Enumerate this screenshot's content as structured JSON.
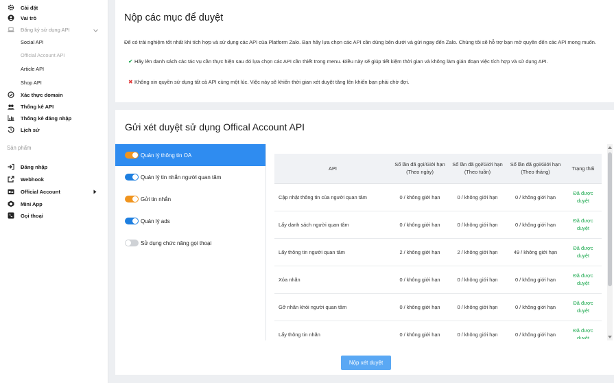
{
  "sidebar": {
    "items": [
      {
        "label": "Cài đặt",
        "icon": "gear-icon"
      },
      {
        "label": "Vai trò",
        "icon": "user-circle-icon"
      },
      {
        "label": "Đăng ký sử dụng API",
        "icon": "laptop-icon"
      },
      {
        "label": "Social API"
      },
      {
        "label": "Official Account API"
      },
      {
        "label": "Article API"
      },
      {
        "label": "Shop API"
      },
      {
        "label": "Xác thực domain",
        "icon": "check-circle-icon"
      },
      {
        "label": "Thống kê API",
        "icon": "users-icon"
      },
      {
        "label": "Thống kê đăng nhập",
        "icon": "bar-chart-icon"
      },
      {
        "label": "Lịch sử",
        "icon": "history-icon"
      }
    ],
    "products_title": "Sản phẩm",
    "products": [
      {
        "label": "Đăng nhập",
        "icon": "sign-in-icon"
      },
      {
        "label": "Webhook",
        "icon": "external-link-icon"
      },
      {
        "label": "Official Account",
        "icon": "oa-icon"
      },
      {
        "label": "Mini App",
        "icon": "mini-app-icon"
      },
      {
        "label": "Gọi thoại",
        "icon": "phone-icon"
      }
    ]
  },
  "intro": {
    "title": "Nộp các mục để duyệt",
    "description": "Để có trải nghiệm tốt nhất khi tích hợp và sử dụng các API của Platform Zalo. Bạn hãy lựa chọn các API cần dùng bên dưới và gửi ngay đến Zalo. Chúng tôi sẽ hỗ trợ bạn mở quyền đến các API mong muốn.",
    "do": "Hãy lên danh sách các tác vụ cần thực hiện sau đó lựa chọn các API cần thiết trong menu. Điều này sẽ giúp tiết kiệm thời gian và không làm gián đoạn việc tích hợp và sử dụng API.",
    "dont": "Không xin quyền sử dụng tất cả API cùng một lúc. Việc này sẽ khiến thời gian xét duyệt tăng lên khiến bạn phải chờ đợi."
  },
  "review": {
    "title": "Gửi xét duyệt sử dụng Offical Account API",
    "groups": [
      {
        "label": "Quản lý thông tin OA",
        "state": "on",
        "color": "#f0941e"
      },
      {
        "label": "Quản lý tin nhắn người quan tâm",
        "state": "on",
        "color": "#1e7fe0"
      },
      {
        "label": "Gửi tin nhắn",
        "state": "on",
        "color": "#f0941e"
      },
      {
        "label": "Quản lý ads",
        "state": "on",
        "color": "#1e7fe0"
      },
      {
        "label": "Sử dụng chức năng gọi thoại",
        "state": "off",
        "color": "#cfd2d6"
      }
    ],
    "table": {
      "headers": [
        "API",
        "Số lần đã gọi/Giới hạn (Theo ngày)",
        "Số lần đã gọi/Giới hạn (Theo tuần)",
        "Số lần đã gọi/Giới hạn (Theo tháng)",
        "Trạng thái"
      ],
      "rows": [
        [
          "Cập nhật thông tin của người quan tâm",
          "0 / không giới hạn",
          "0 / không giới hạn",
          "0 / không giới hạn",
          "Đã được duyệt"
        ],
        [
          "Lấy danh sách người quan tâm",
          "0 / không giới hạn",
          "0 / không giới hạn",
          "0 / không giới hạn",
          "Đã được duyệt"
        ],
        [
          "Lấy thông tin người quan tâm",
          "2 / không giới hạn",
          "2 / không giới hạn",
          "49 / không giới hạn",
          "Đã được duyệt"
        ],
        [
          "Xóa nhãn",
          "0 / không giới hạn",
          "0 / không giới hạn",
          "0 / không giới hạn",
          "Đã được duyệt"
        ],
        [
          "Gỡ nhãn khỏi người quan tâm",
          "0 / không giới hạn",
          "0 / không giới hạn",
          "0 / không giới hạn",
          "Đã được duyệt"
        ],
        [
          "Lấy thông tin nhãn",
          "0 / không giới hạn",
          "0 / không giới hạn",
          "0 / không giới hạn",
          "Đã được duyệt"
        ]
      ]
    },
    "submit_label": "Nộp xét duyệt"
  },
  "colors": {
    "accent": "#2f8cf0",
    "approved": "#1aa84d",
    "check": "#1aa84d",
    "cross": "#e03a3a"
  }
}
